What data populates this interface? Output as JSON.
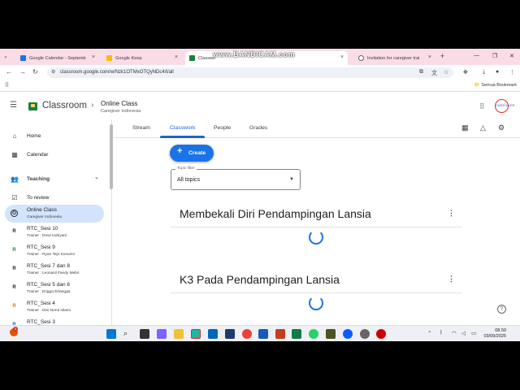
{
  "browser": {
    "tabs": [
      {
        "label": "Google Calendar - Septemb",
        "favicon_color": "#1a73e8"
      },
      {
        "label": "Google Keep",
        "favicon_color": "#fbbc04"
      },
      {
        "label": "Classwo",
        "favicon_color": "#188038"
      },
      {
        "label": "Invitation for caregiver trai",
        "favicon_color": "#5f6368"
      }
    ],
    "watermark": "www.BANDICAM.com",
    "url": "classroom.google.com/w/Nzk1OTMxOTQyNDc4/t/all",
    "all_bookmarks": "Semua Bookmark"
  },
  "header": {
    "brand": "Classroom",
    "class_name": "Online Class",
    "class_subtitle": "Caregiver Indonesia",
    "avatar_text": "CAREGIVER"
  },
  "sidebar": {
    "home": "Home",
    "calendar": "Calendar",
    "teaching": "Teaching",
    "to_review": "To review",
    "selected": {
      "name": "Online Class",
      "sub": "Caregiver Indonesia",
      "initial": "O"
    },
    "classes": [
      {
        "initial": "R",
        "name": "RTC_Sesi 10",
        "sub": "Trainer : Dewi Indriyani",
        "color": "#1e8e3e"
      },
      {
        "initial": "R",
        "name": "RTC_Sesi 9",
        "sub": "Trainer : Ryan Tejo Kusumo",
        "color": "#1e8e3e"
      },
      {
        "initial": "R",
        "name": "RTC_Sesi 7 dan 8",
        "sub": "Trainer : Leonard Fandy Mebs",
        "color": "#202124"
      },
      {
        "initial": "R",
        "name": "RTC_Sesi 5 dan 6",
        "sub": "Trainer : Erigga Erlangga",
        "color": "#202124"
      },
      {
        "initial": "R",
        "name": "RTC_Sesi 4",
        "sub": "Trainer : Dini Nurul Islami",
        "color": "#e37400"
      },
      {
        "initial": "R",
        "name": "RTC_Sesi 3",
        "sub": "",
        "color": "#1967d2"
      }
    ]
  },
  "main": {
    "tabs": [
      "Stream",
      "Classwork",
      "People",
      "Grades"
    ],
    "active_tab": "Classwork",
    "create_label": "Create",
    "filter": {
      "label": "Topic filter",
      "value": "All topics"
    },
    "topics": [
      "Membekali Diri Pendampingan Lansia",
      "K3 Pada Pendampingan Lansia"
    ]
  },
  "taskbar": {
    "time": "08.50",
    "date": "03/09/2025",
    "notification_count": "3"
  },
  "colors": {
    "accent": "#1a73e8",
    "tab_bar": "#f9dce6",
    "selected": "#d2e3fc"
  }
}
